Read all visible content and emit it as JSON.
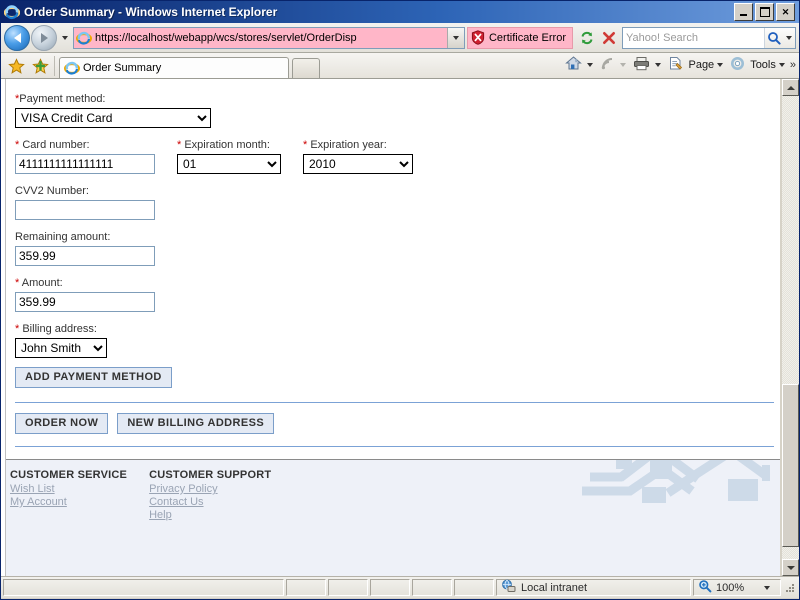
{
  "window": {
    "title": "Order Summary - Windows Internet Explorer",
    "minimize_label": "Minimize",
    "maximize_label": "Maximize",
    "close_label": "Close"
  },
  "navigation": {
    "back_icon": "back-arrow-icon",
    "forward_icon": "forward-arrow-icon",
    "history_dropdown_icon": "chevron-down-icon",
    "url": "https://localhost/webapp/wcs/stores/servlet/OrderDisp",
    "address_dropdown_icon": "chevron-down-icon",
    "certificate_error_label": "Certificate Error",
    "certificate_error_icon": "error-shield-icon",
    "refresh_icon": "refresh-icon",
    "stop_icon": "stop-icon",
    "search_placeholder": "Yahoo! Search",
    "search_value": "",
    "search_icon": "search-icon",
    "search_dropdown_icon": "chevron-down-icon"
  },
  "tabs": {
    "favorites_icon": "favorites-star-icon",
    "add_favorite_icon": "add-favorite-star-icon",
    "items": [
      {
        "label": "Order Summary",
        "icon": "ie-page-icon",
        "active": true
      }
    ],
    "new_tab_label": ""
  },
  "command_bar": {
    "home_label": "Home",
    "home_icon": "home-icon",
    "feeds_icon": "rss-feed-icon",
    "print_icon": "printer-icon",
    "page_label": "Page",
    "page_icon": "page-icon",
    "tools_label": "Tools",
    "tools_icon": "gear-icon",
    "overflow_label": "»"
  },
  "page": {
    "payment_method": {
      "label": "Payment method:",
      "required": true,
      "value": "VISA Credit Card",
      "options": [
        "VISA Credit Card"
      ]
    },
    "card_number": {
      "label": "Card number:",
      "required": true,
      "value": "4111111111111111"
    },
    "expiration_month": {
      "label": "Expiration month:",
      "required": true,
      "value": "01",
      "options": [
        "01"
      ]
    },
    "expiration_year": {
      "label": "Expiration year:",
      "required": true,
      "value": "2010",
      "options": [
        "2010"
      ]
    },
    "cvv2": {
      "label": "CVV2 Number:",
      "required": false,
      "value": "",
      "placeholder": ""
    },
    "remaining_amount": {
      "label": "Remaining amount:",
      "required": false,
      "value": "359.99"
    },
    "amount": {
      "label": "Amount:",
      "required": true,
      "value": "359.99"
    },
    "billing_address": {
      "label": "Billing address:",
      "required": true,
      "value": "John Smith",
      "options": [
        "John Smith"
      ]
    },
    "buttons": {
      "add_payment_method": "ADD PAYMENT METHOD",
      "order_now": "ORDER NOW",
      "new_billing_address": "NEW BILLING ADDRESS"
    },
    "footer": {
      "columns": [
        {
          "heading": "CUSTOMER SERVICE",
          "links": [
            "Wish List",
            "My Account"
          ]
        },
        {
          "heading": "CUSTOMER SUPPORT",
          "links": [
            "Privacy Policy",
            "Contact Us",
            "Help"
          ]
        }
      ],
      "decoration_icon": "rooftops-watermark-icon"
    },
    "required_marker": "*"
  },
  "scrollbar": {
    "up_icon": "scroll-up-arrow-icon",
    "down_icon": "scroll-down-arrow-icon",
    "thumb_label": "vertical-scroll-thumb"
  },
  "status_bar": {
    "message": "",
    "zone_label": "Local intranet",
    "zone_icon": "intranet-zone-icon",
    "zoom_label": "100%",
    "zoom_icon": "zoom-magnifier-icon",
    "zoom_dropdown_icon": "chevron-down-icon",
    "resize_grip_icon": "resize-grip-icon"
  },
  "colors": {
    "title_bar": "#0a246a",
    "cert_error_bg": "#ffb6c8",
    "required_red": "#cc0000",
    "button_bg": "#e4eaf4",
    "button_border": "#7b9ec9",
    "footer_bg": "#eef1f8",
    "divider_blue": "#7ba2d6"
  }
}
